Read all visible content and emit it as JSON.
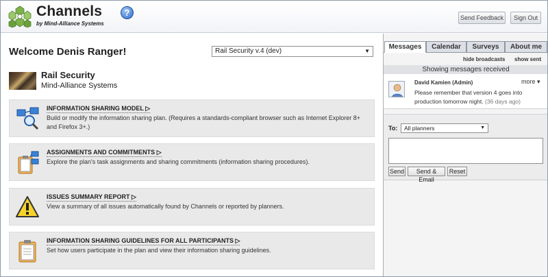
{
  "header": {
    "brand": "Channels",
    "brand_sub": "by Mind-Alliance Systems",
    "help": "?",
    "send_feedback": "Send Feedback",
    "sign_out": "Sign Out"
  },
  "main": {
    "welcome": "Welcome Denis Ranger!",
    "plan_selector": "Rail Security v.4 (dev)",
    "plan": {
      "name": "Rail Security",
      "org": "Mind-Alliance Systems"
    },
    "sections": [
      {
        "icon": "magnifier-network-icon",
        "title": "INFORMATION SHARING MODEL",
        "desc": "Build or modify the information sharing plan. (Requires a standards-compliant browser such as Internet Explorer 8+ and Firefox 3+.)"
      },
      {
        "icon": "clipboard-network-icon",
        "title": "ASSIGNMENTS AND COMMITMENTS",
        "desc": "Explore the plan's task assignments and sharing commitments (information sharing procedures)."
      },
      {
        "icon": "warning-icon",
        "title": "ISSUES SUMMARY REPORT",
        "desc": "View a summary of all issues automatically found by Channels or reported by planners."
      },
      {
        "icon": "clipboard-icon",
        "title": "INFORMATION SHARING GUIDELINES FOR ALL PARTICIPANTS",
        "desc": "Set how users participate in the plan and view their information sharing guidelines."
      }
    ]
  },
  "sidebar": {
    "tabs": [
      "Messages",
      "Calendar",
      "Surveys",
      "About me"
    ],
    "active_tab": "Messages",
    "hide_broadcasts": "hide broadcasts",
    "show_sent": "show sent",
    "showing": "Showing messages received",
    "message": {
      "sender": "David Kamien (Admin)",
      "more": "more",
      "text": "Please remember that version 4 goes into production tomorrow night.",
      "age": "(36 days ago)"
    },
    "compose": {
      "to_label": "To:",
      "to_value": "All planners",
      "buttons": [
        "Send",
        "Send & Email",
        "Reset"
      ]
    }
  },
  "colors": {
    "accent": "#2f6fcd",
    "panel_gray": "#e9e9e9",
    "sidebar_bg": "#f4f4f4"
  }
}
